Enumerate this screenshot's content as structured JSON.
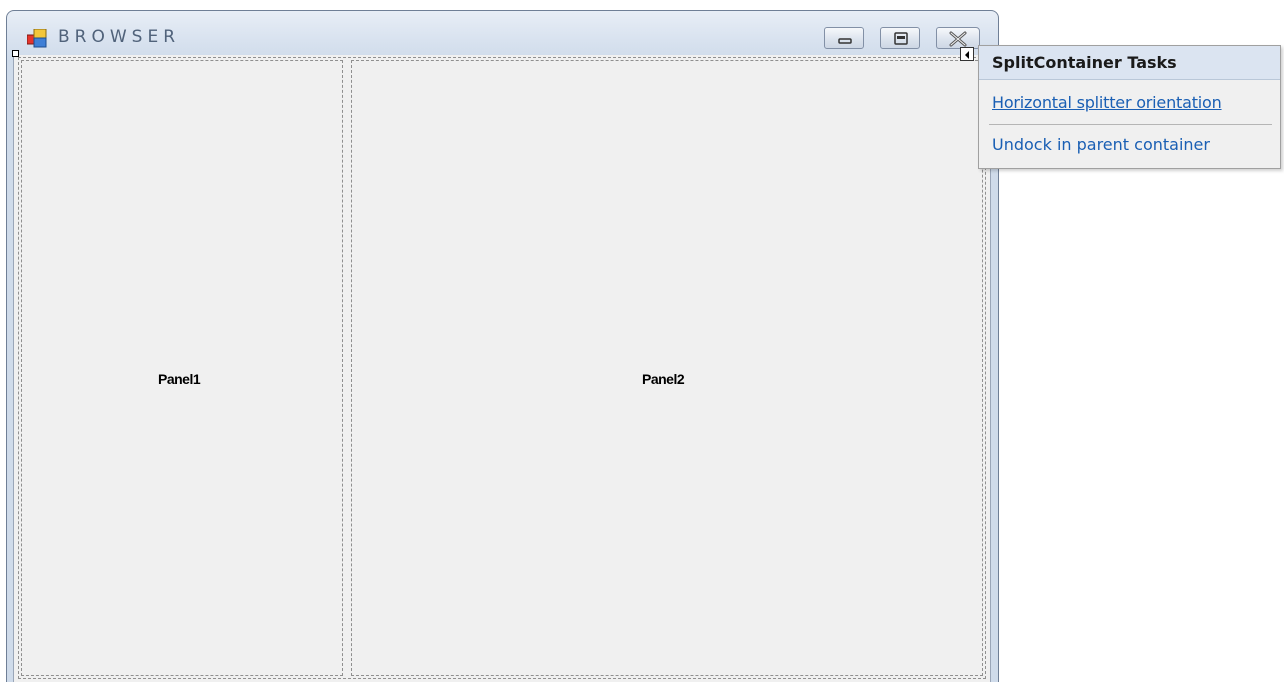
{
  "window": {
    "title": "BROWSER"
  },
  "split_container": {
    "panel1_label": "Panel1",
    "panel2_label": "Panel2"
  },
  "tasks": {
    "title": "SplitContainer Tasks",
    "items": [
      {
        "label": "Horizontal splitter orientation"
      },
      {
        "label": "Undock in parent container"
      }
    ]
  },
  "icons": {
    "app": "app-form-icon",
    "minimize": "minimize-icon",
    "maximize": "maximize-icon",
    "close": "close-icon",
    "smart_tag": "smart-tag-arrow-icon"
  },
  "colors": {
    "link": "#1a5fb4",
    "title_text": "#50627a",
    "panel_bg": "#f0f0f0",
    "tasks_header_bg": "#dbe4f1"
  }
}
